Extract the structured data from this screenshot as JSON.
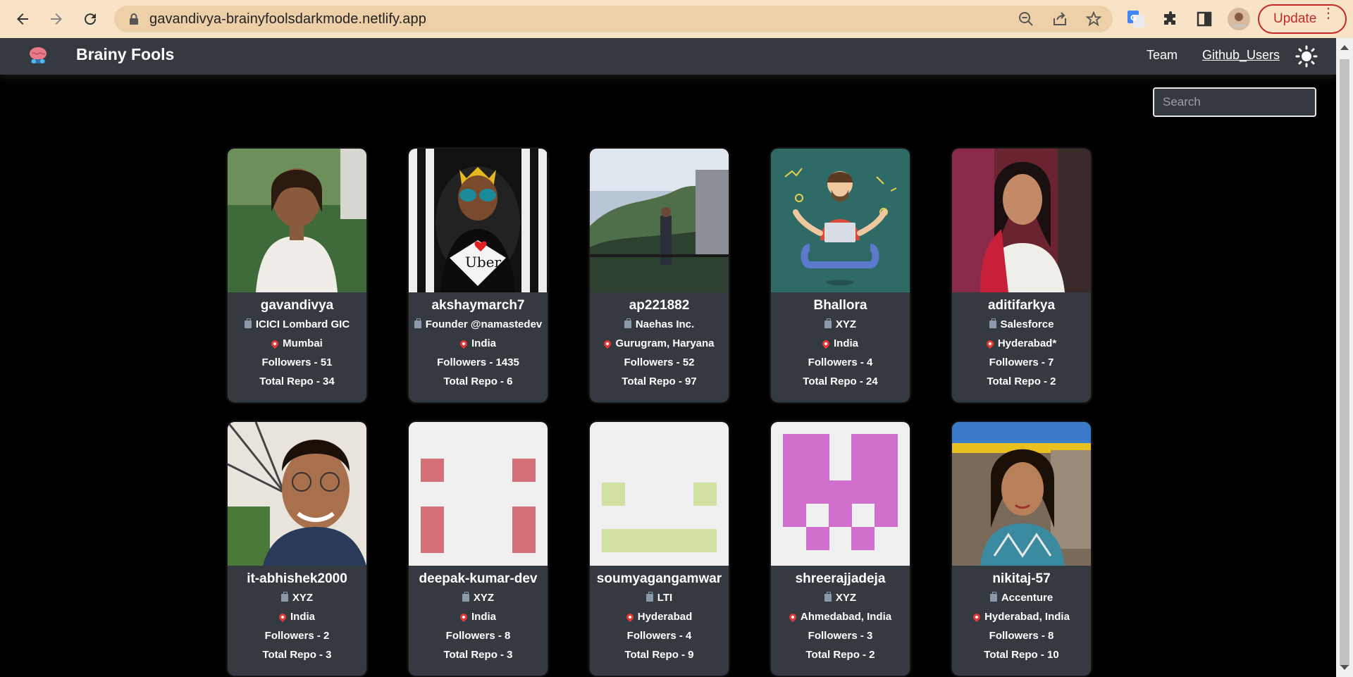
{
  "browser": {
    "url": "gavandivya-brainyfoolsdarkmode.netlify.app",
    "update_label": "Update"
  },
  "app": {
    "brand": "Brainy Fools",
    "nav": {
      "team": "Team",
      "github_users": "Github_Users"
    },
    "search_placeholder": "Search"
  },
  "users": [
    {
      "username": "gavandivya",
      "company": "ICICI Lombard GIC",
      "location": "Mumbai",
      "followers": "Followers - 51",
      "repos": "Total Repo - 34"
    },
    {
      "username": "akshaymarch7",
      "company": "Founder @namastedev",
      "location": "India",
      "followers": "Followers - 1435",
      "repos": "Total Repo - 6"
    },
    {
      "username": "ap221882",
      "company": "Naehas Inc.",
      "location": "Gurugram, Haryana",
      "followers": "Followers - 52",
      "repos": "Total Repo - 97"
    },
    {
      "username": "Bhallora",
      "company": "XYZ",
      "location": "India",
      "followers": "Followers - 4",
      "repos": "Total Repo - 24"
    },
    {
      "username": "aditifarkya",
      "company": "Salesforce",
      "location": "Hyderabad*",
      "followers": "Followers - 7",
      "repos": "Total Repo - 2"
    },
    {
      "username": "it-abhishek2000",
      "company": "XYZ",
      "location": "India",
      "followers": "Followers - 2",
      "repos": "Total Repo - 3"
    },
    {
      "username": "deepak-kumar-dev",
      "company": "XYZ",
      "location": "India",
      "followers": "Followers - 8",
      "repos": "Total Repo - 3"
    },
    {
      "username": "soumyagangamwar",
      "company": "LTI",
      "location": "Hyderabad",
      "followers": "Followers - 4",
      "repos": "Total Repo - 9"
    },
    {
      "username": "shreerajjadeja",
      "company": "XYZ",
      "location": "Ahmedabad, India",
      "followers": "Followers - 3",
      "repos": "Total Repo - 2"
    },
    {
      "username": "nikitaj-57",
      "company": "Accenture",
      "location": "Hyderabad, India",
      "followers": "Followers - 8",
      "repos": "Total Repo - 10"
    }
  ],
  "colors": {
    "chrome_bg": "#f8e3c6",
    "navbar_bg": "#343a40",
    "card_bg": "#343a40",
    "page_bg": "#000000",
    "update_red": "#c62828"
  }
}
